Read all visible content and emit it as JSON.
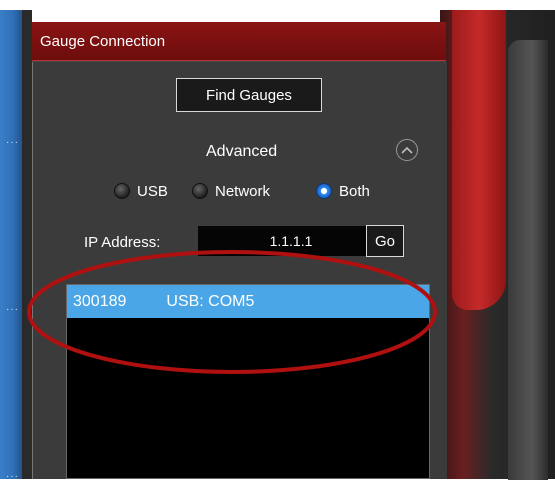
{
  "panel": {
    "title": "Gauge Connection",
    "find_button": "Find Gauges",
    "advanced_label": "Advanced",
    "advanced_toggle_icon": "chevron-up-icon",
    "connection_modes": [
      {
        "label": "USB",
        "checked": false
      },
      {
        "label": "Network",
        "checked": false
      },
      {
        "label": "Both",
        "checked": true
      }
    ],
    "ip_label": "IP Address:",
    "ip_value": "1.1.1.1",
    "go_button": "Go",
    "gauges": [
      {
        "id": "300189",
        "port": "USB: COM5",
        "selected": true
      }
    ]
  },
  "annotation": {
    "shape": "ellipse",
    "color": "#b01010"
  },
  "colors": {
    "title_bar": "#7a1010",
    "selection": "#4aa6e6",
    "panel": "#3b3b3b"
  }
}
